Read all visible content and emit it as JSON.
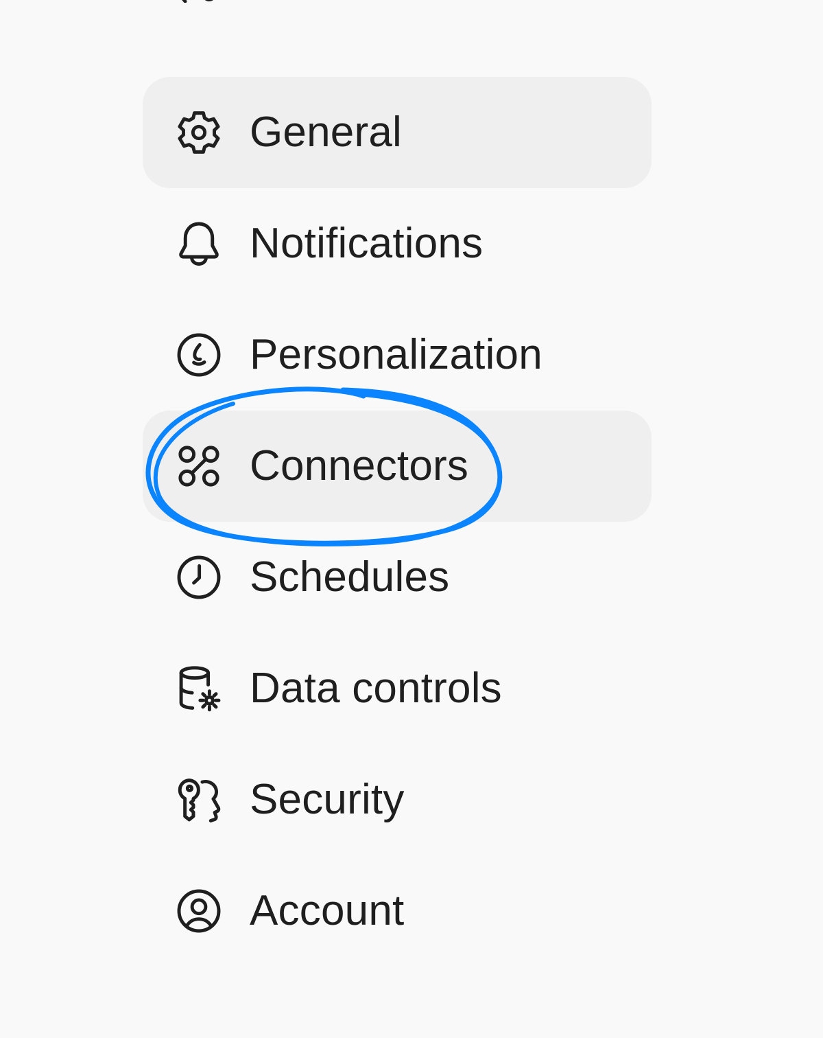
{
  "sidebar": {
    "items": [
      {
        "label": "General",
        "icon": "gear-icon",
        "active": true
      },
      {
        "label": "Notifications",
        "icon": "bell-icon",
        "active": false
      },
      {
        "label": "Personalization",
        "icon": "personalization-icon",
        "active": false
      },
      {
        "label": "Connectors",
        "icon": "connectors-icon",
        "active": true
      },
      {
        "label": "Schedules",
        "icon": "clock-icon",
        "active": false
      },
      {
        "label": "Data controls",
        "icon": "database-gear-icon",
        "active": false
      },
      {
        "label": "Security",
        "icon": "key-icon",
        "active": false
      },
      {
        "label": "Account",
        "icon": "user-circle-icon",
        "active": false
      }
    ]
  },
  "annotation": {
    "target": "Connectors",
    "color": "#0a84ff"
  },
  "colors": {
    "background": "#f9f9f9",
    "active_item": "#efefef",
    "text": "#1f1f1f"
  }
}
